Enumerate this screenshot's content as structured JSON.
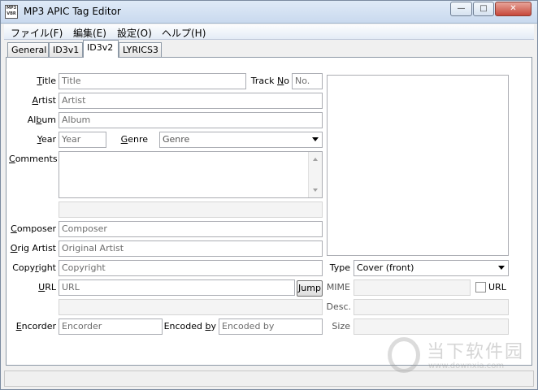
{
  "window": {
    "title": "MP3 APIC Tag Editor",
    "icon_text": "MP3 VBR",
    "controls": {
      "minimize": "—",
      "maximize": "□",
      "close": "✕"
    }
  },
  "menu": [
    "ファイル(F)",
    "編集(E)",
    "設定(O)",
    "ヘルプ(H)"
  ],
  "tabs": [
    "General",
    "ID3v1",
    "ID3v2",
    "LYRICS3"
  ],
  "active_tab": "ID3v2",
  "form": {
    "title": {
      "label_pre": "",
      "label_u": "T",
      "label_post": "itle",
      "value": "Title"
    },
    "track": {
      "label_pre": "Track ",
      "label_u": "N",
      "label_post": "o",
      "value": "No."
    },
    "artist": {
      "label_pre": "",
      "label_u": "A",
      "label_post": "rtist",
      "value": "Artist"
    },
    "album": {
      "label_pre": "Al",
      "label_u": "b",
      "label_post": "um",
      "value": "Album"
    },
    "year": {
      "label_pre": "",
      "label_u": "Y",
      "label_post": "ear",
      "value": "Year"
    },
    "genre": {
      "label_pre": "",
      "label_u": "G",
      "label_post": "enre",
      "value": "Genre"
    },
    "comments": {
      "label_pre": "",
      "label_u": "C",
      "label_post": "omments",
      "value": ""
    },
    "composer": {
      "label_pre": "",
      "label_u": "C",
      "label_post": "omposer",
      "value": "Composer"
    },
    "orig_artist": {
      "label_pre": "",
      "label_u": "O",
      "label_post": "rig Artist",
      "value": "Original Artist"
    },
    "copyright": {
      "label_pre": "Copy",
      "label_u": "r",
      "label_post": "ight",
      "value": "Copyright"
    },
    "url": {
      "label_pre": "",
      "label_u": "U",
      "label_post": "RL",
      "value": "URL"
    },
    "jump_button": "Jump",
    "encorder": {
      "label_pre": "",
      "label_u": "E",
      "label_post": "ncorder",
      "value": "Encorder"
    },
    "encoded_by": {
      "label_pre": "Encoded ",
      "label_u": "b",
      "label_post": "y",
      "value": "Encoded by"
    }
  },
  "picture": {
    "type_label": "Type",
    "type_value": "Cover (front)",
    "mime_label": "MIME",
    "url_checkbox_label": "URL",
    "desc_label": "Desc.",
    "size_label": "Size"
  },
  "watermark": {
    "name": "当下软件园",
    "url": "www.downxia.com"
  }
}
